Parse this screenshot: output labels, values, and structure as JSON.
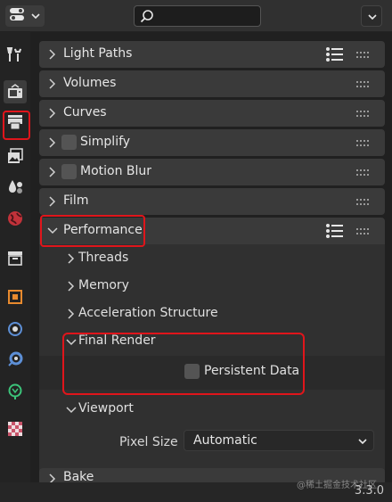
{
  "header": {
    "editor_type_icon": "toggle-icon",
    "search_icon": "search-icon",
    "search_value": "",
    "options_icon": "chevron-down-icon"
  },
  "tabs": [
    {
      "name": "tool",
      "icon": "wrench-screwdriver-icon",
      "active": false
    },
    {
      "name": "render",
      "icon": "camera-back-icon",
      "active": true,
      "highlighted": true
    },
    {
      "name": "output",
      "icon": "printer-icon",
      "active": false
    },
    {
      "name": "view-layer",
      "icon": "image-stack-icon",
      "active": false
    },
    {
      "name": "scene",
      "icon": "scene-icon",
      "active": false
    },
    {
      "name": "world",
      "icon": "globe-icon",
      "active": false
    },
    {
      "name": "collection",
      "icon": "box-icon",
      "active": false
    },
    {
      "name": "object",
      "icon": "orange-square-icon",
      "active": false
    },
    {
      "name": "modifiers",
      "icon": "blue-circle-icon",
      "active": false
    },
    {
      "name": "particles",
      "icon": "blue-ring-icon",
      "active": false
    },
    {
      "name": "physics",
      "icon": "green-circle-icon",
      "active": false
    },
    {
      "name": "texture",
      "icon": "checker-icon",
      "active": false
    }
  ],
  "panels": {
    "light_paths": "Light Paths",
    "volumes": "Volumes",
    "curves": "Curves",
    "simplify": "Simplify",
    "motion_blur": "Motion Blur",
    "film": "Film",
    "performance": "Performance",
    "bake": "Bake"
  },
  "performance": {
    "threads": "Threads",
    "memory": "Memory",
    "acceleration_structure": "Acceleration Structure",
    "final_render": "Final Render",
    "persistent_data": "Persistent Data",
    "viewport": "Viewport",
    "pixel_size_label": "Pixel Size",
    "pixel_size_value": "Automatic"
  },
  "status": {
    "version": "3.3.0",
    "watermark": "@稀土掘金技术社区"
  },
  "colors": {
    "highlight": "#e0151b",
    "panel": "#3a3a3a",
    "background": "#1d1d1d"
  }
}
